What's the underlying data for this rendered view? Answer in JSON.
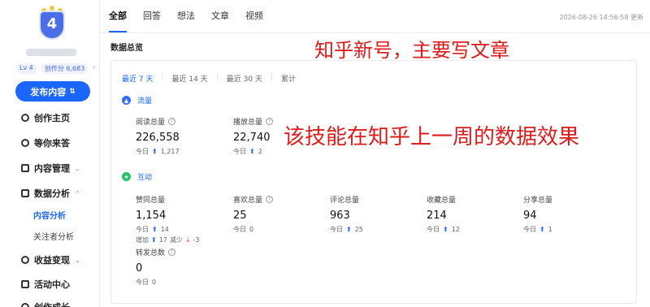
{
  "sidebar": {
    "badge_level": "4",
    "level_tag": "Lv 4",
    "creation_score": "创作分 6,683",
    "publish_label": "发布内容",
    "nav": [
      {
        "label": "创作主页",
        "icon": "person-icon"
      },
      {
        "label": "等你来答",
        "icon": "compass-icon"
      },
      {
        "label": "内容管理",
        "icon": "document-icon"
      },
      {
        "label": "数据分析",
        "icon": "chart-icon"
      },
      {
        "label": "收益变现",
        "icon": "money-icon"
      },
      {
        "label": "活动中心",
        "icon": "flag-icon"
      },
      {
        "label": "创作成长",
        "icon": "growth-icon"
      }
    ],
    "sub_nav": [
      {
        "label": "内容分析",
        "active": true
      },
      {
        "label": "关注者分析",
        "active": false
      }
    ]
  },
  "main": {
    "tabs": [
      "全部",
      "回答",
      "想法",
      "文章",
      "视频"
    ],
    "active_tab": "全部",
    "updated_at": "2026-08-26 14:56:58 更新",
    "section_title": "数据总览",
    "ranges": [
      "最近 7 天",
      "最近 14 天",
      "最近 30 天",
      "累计"
    ],
    "active_range": "最近 7 天",
    "traffic": {
      "title": "流量",
      "metrics": [
        {
          "label": "阅读总量",
          "value": "226,558",
          "today_label": "今日",
          "today_value": "1,217"
        },
        {
          "label": "播放总量",
          "value": "22,740",
          "today_label": "今日",
          "today_value": "2"
        }
      ]
    },
    "interaction": {
      "title": "互动",
      "metrics": [
        {
          "label": "赞同总量",
          "value": "1,154",
          "today_label": "今日",
          "today_value": "14",
          "inc_label": "增加",
          "inc_value": "17",
          "dec_label": "减少",
          "dec_value": "-3"
        },
        {
          "label": "喜欢总量",
          "value": "25",
          "today_label": "今日",
          "today_value": "0"
        },
        {
          "label": "评论总量",
          "value": "963",
          "today_label": "今日",
          "today_value": "25"
        },
        {
          "label": "收藏总量",
          "value": "214",
          "today_label": "今日",
          "today_value": "12"
        },
        {
          "label": "分享总量",
          "value": "94",
          "today_label": "今日",
          "today_value": "1"
        },
        {
          "label": "转发总数",
          "value": "0",
          "today_label": "今日",
          "today_value": "0"
        }
      ]
    }
  },
  "annotations": {
    "top": "知乎新号，主要写文章",
    "middle": "该技能在知乎上一周的数据效果"
  },
  "colors": {
    "accent": "#1a66ff",
    "annotation": "#e01b1b",
    "interaction_icon": "#20c46a"
  }
}
